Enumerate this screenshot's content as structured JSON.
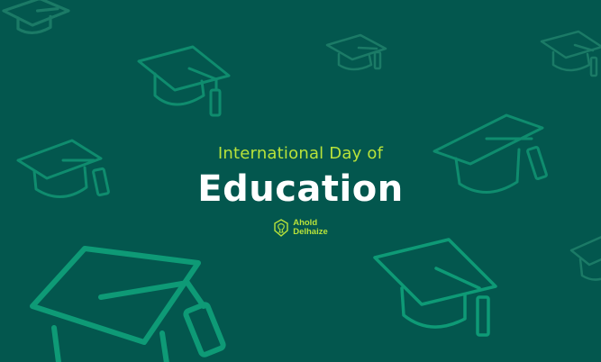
{
  "heading": {
    "subtitle": "International Day of",
    "title": "Education"
  },
  "brand": {
    "line1": "Ahold",
    "line2": "Delhaize",
    "logo_icon": "lion-emblem-icon"
  },
  "decor": {
    "icon": "graduation-cap-icon",
    "background_color": "#03574e",
    "cap_color": "#0f8c6e",
    "accent_color": "#b9e33a"
  }
}
